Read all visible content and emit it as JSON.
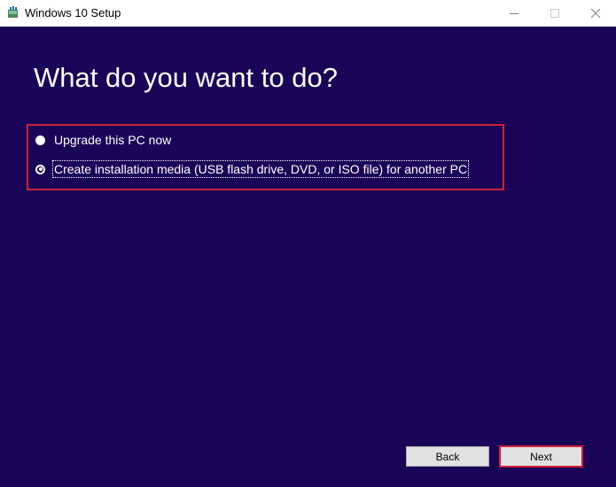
{
  "window": {
    "title": "Windows 10 Setup",
    "icon": "windows-setup-icon",
    "controls": [
      "minimize",
      "maximize",
      "close"
    ]
  },
  "page": {
    "heading": "What do you want to do?"
  },
  "options": [
    {
      "label": "Upgrade this PC now",
      "selected": false
    },
    {
      "label": "Create installation media (USB flash drive, DVD, or ISO file) for another PC",
      "selected": true
    }
  ],
  "buttons": {
    "back": "Back",
    "next": "Next"
  },
  "colors": {
    "background": "#1a0457",
    "highlight": "#d01f3c",
    "text": "#ffffff"
  }
}
